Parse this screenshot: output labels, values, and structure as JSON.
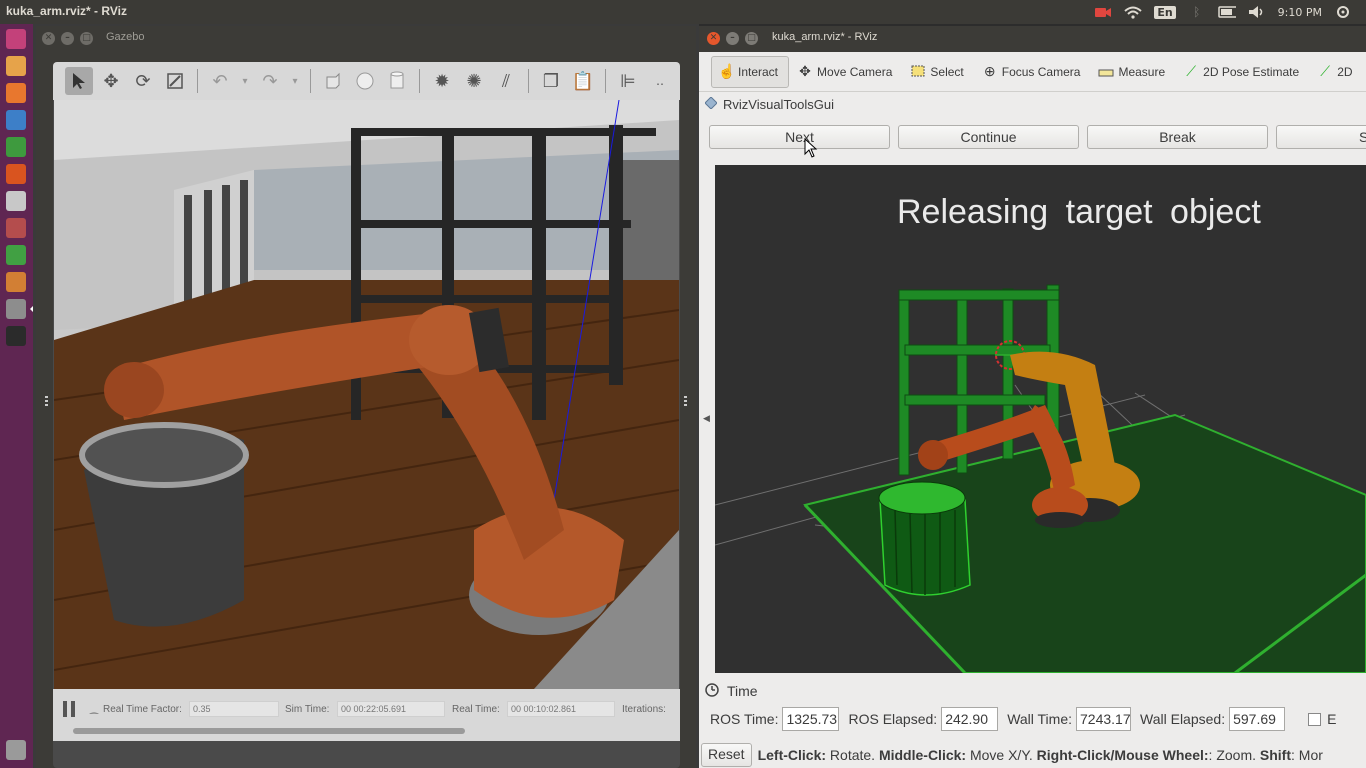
{
  "top_panel": {
    "title": "kuka_arm.rviz* - RViz",
    "lang": "En",
    "clock": "9:10 PM"
  },
  "launcher": {
    "items": [
      {
        "icon": "ubuntu-dash-icon",
        "color": "#c3417a"
      },
      {
        "icon": "files-icon",
        "color": "#e6a34a"
      },
      {
        "icon": "firefox-icon",
        "color": "#e8772e"
      },
      {
        "icon": "writer-icon",
        "color": "#3d7fc8"
      },
      {
        "icon": "calc-icon",
        "color": "#3e9a3e"
      },
      {
        "icon": "impress-icon",
        "color": "#d9541f"
      },
      {
        "icon": "amazon-icon",
        "color": "#c8c8c8"
      },
      {
        "icon": "settings-icon",
        "color": "#b44d4d"
      },
      {
        "icon": "qtcreator-icon",
        "color": "#41a043"
      },
      {
        "icon": "software-icon",
        "color": "#d27f34"
      },
      {
        "icon": "rviz-icon",
        "color": "#8d8d8d"
      },
      {
        "icon": "terminal-icon",
        "color": "#2b2b2b"
      },
      {
        "icon": "trash-icon",
        "color": "#9a9a9a"
      }
    ]
  },
  "gazebo": {
    "title": "Gazebo",
    "status": {
      "rtf_label": "Real Time Factor:",
      "rtf_value": "0.35",
      "sim_label": "Sim Time:",
      "sim_value": "00 00:22:05.691",
      "real_label": "Real Time:",
      "real_value": "00 00:10:02.861",
      "iter_label": "Iterations:"
    }
  },
  "rviz": {
    "title": "kuka_arm.rviz* - RViz",
    "tools": [
      {
        "label": "Interact",
        "icon": "hand-icon"
      },
      {
        "label": "Move Camera",
        "icon": "move-camera-icon"
      },
      {
        "label": "Select",
        "icon": "select-icon"
      },
      {
        "label": "Focus Camera",
        "icon": "focus-camera-icon"
      },
      {
        "label": "Measure",
        "icon": "measure-icon"
      },
      {
        "label": "2D Pose Estimate",
        "icon": "pose-estimate-icon"
      },
      {
        "label": "2D",
        "icon": "nav-goal-icon"
      }
    ],
    "panel_title": "RvizVisualToolsGui",
    "buttons": {
      "next": "Next",
      "continue": "Continue",
      "break": "Break",
      "stop": "St"
    },
    "overlay_text": "Releasing  target  object",
    "time": {
      "title": "Time",
      "ros_time_label": "ROS Time:",
      "ros_time": "1325.73",
      "ros_elapsed_label": "ROS Elapsed:",
      "ros_elapsed": "242.90",
      "wall_time_label": "Wall Time:",
      "wall_time": "7243.17",
      "wall_elapsed_label": "Wall Elapsed:",
      "wall_elapsed": "597.69",
      "exp_label": "E"
    },
    "bottom": {
      "reset": "Reset",
      "h1": "Left-Click:",
      "t1": " Rotate. ",
      "h2": "Middle-Click:",
      "t2": " Move X/Y. ",
      "h3": "Right-Click/Mouse Wheel:",
      "t3": ": Zoom. ",
      "h4": "Shift",
      "t4": ": Mor"
    }
  }
}
